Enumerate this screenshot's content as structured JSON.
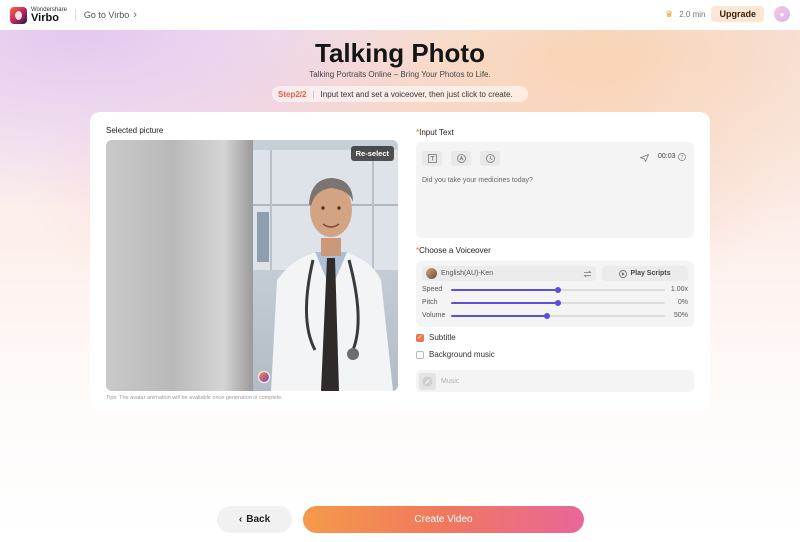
{
  "topbar": {
    "logo_brand": "Wondershare",
    "logo_product": "Virbo",
    "goto_label": "Go to Virbo",
    "credits": "2.0 min",
    "upgrade_label": "Upgrade"
  },
  "header": {
    "title": "Talking Photo",
    "subtitle": "Talking Portraits Online – Bring Your Photos to Life.",
    "step_tag": "Step2/2",
    "step_text": "Input text and set a voiceover, then just click to create."
  },
  "picture": {
    "label": "Selected picture",
    "reselect_label": "Re-select",
    "tips": "Tips: The avatar animation will be available once generation is complete."
  },
  "input_text": {
    "required_mark": "*",
    "label": "Input Text",
    "duration": "00:03",
    "value": "Did you take your medicines today?"
  },
  "voiceover": {
    "required_mark": "*",
    "label": "Choose a Voiceover",
    "selected_voice": "English(AU)-Ken",
    "play_label": "Play Scripts",
    "sliders": [
      {
        "label": "Speed",
        "value": "1.00x",
        "level": 0.5
      },
      {
        "label": "Pitch",
        "value": "0%",
        "level": 0.5
      },
      {
        "label": "Volume",
        "value": "50%",
        "level": 0.45
      }
    ]
  },
  "options": {
    "subtitle_label": "Subtitle",
    "subtitle_checked": true,
    "music_label": "Background music",
    "music_checked": false,
    "music_placeholder": "Music"
  },
  "footer": {
    "back_label": "Back",
    "create_label": "Create Video"
  },
  "colors": {
    "accent": "#e0623e",
    "slider": "#5b4fd6",
    "create_start": "#f59a4a",
    "create_end": "#e8669a"
  }
}
